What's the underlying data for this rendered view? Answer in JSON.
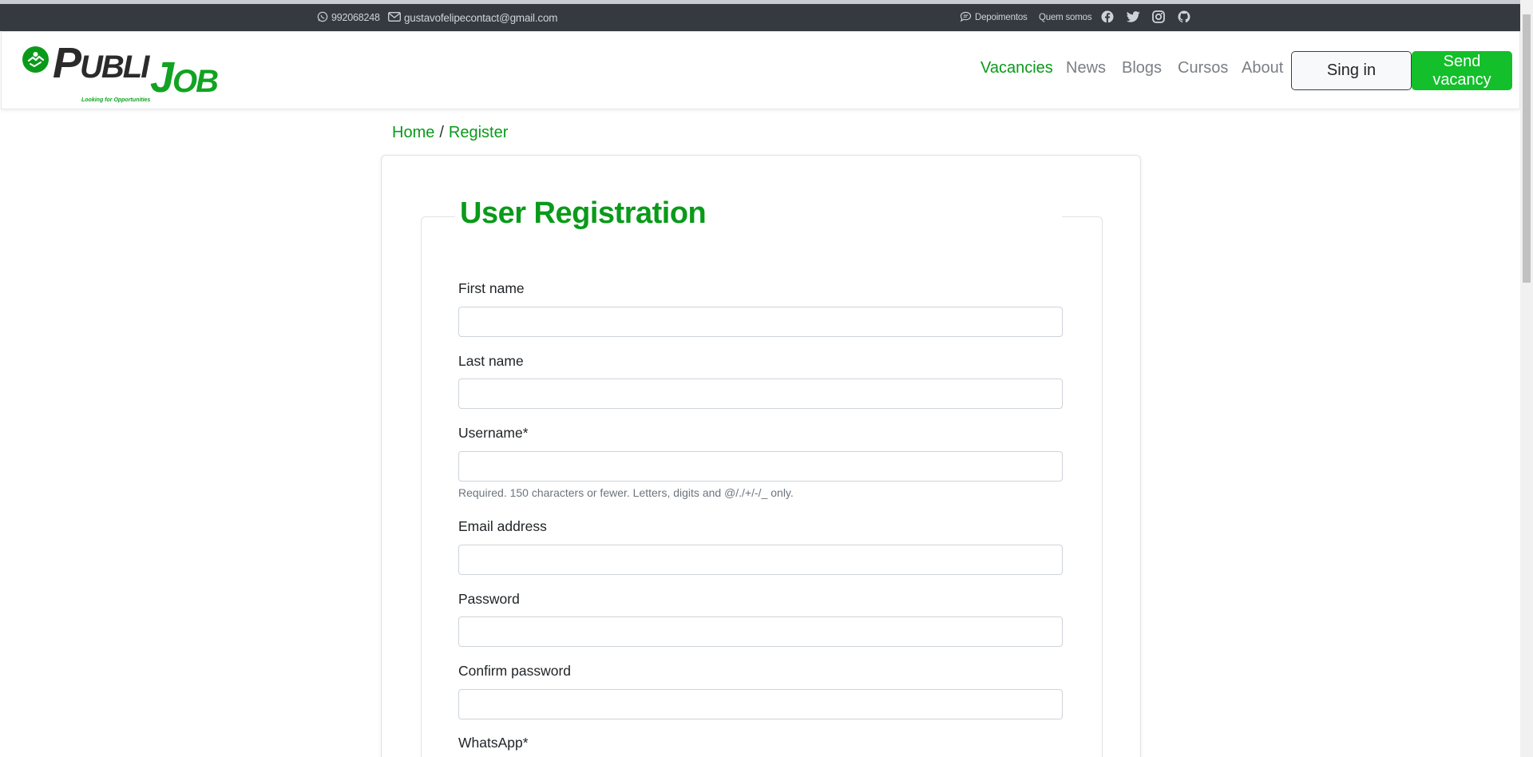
{
  "topbar": {
    "phone": "992068248",
    "email": "gustavofelipecontact@gmail.com",
    "testimonials": "Depoimentos",
    "about_us": "Quem somos",
    "phone_icon": "whatsapp-icon",
    "email_icon": "envelope-icon",
    "testimonials_icon": "chat-icon",
    "social_icons": [
      "facebook-icon",
      "twitter-icon",
      "instagram-icon",
      "github-icon"
    ]
  },
  "logo": {
    "word1_big": "P",
    "word1_rest": "UBLI",
    "word2_big": "J",
    "word2_rest": "OB",
    "tagline": "Looking for Opportunities"
  },
  "nav": {
    "items": [
      {
        "label": "Vacancies",
        "active": true
      },
      {
        "label": "News",
        "active": false
      },
      {
        "label": "Blogs",
        "active": false
      },
      {
        "label": "Cursos",
        "active": false
      },
      {
        "label": "About",
        "active": false
      }
    ],
    "signin": "Sing in",
    "send_vacancy": "Send vacancy"
  },
  "breadcrumb": {
    "home": "Home",
    "separator": "/",
    "current": "Register"
  },
  "form": {
    "title": "User Registration",
    "first_name": {
      "label": "First name",
      "value": ""
    },
    "last_name": {
      "label": "Last name",
      "value": ""
    },
    "username": {
      "label": "Username*",
      "value": "",
      "help": "Required. 150 characters or fewer. Letters, digits and @/./+/-/_ only."
    },
    "email": {
      "label": "Email address",
      "value": ""
    },
    "password": {
      "label": "Password",
      "value": ""
    },
    "confirm_password": {
      "label": "Confirm password",
      "value": ""
    },
    "whatsapp": {
      "label": "WhatsApp*"
    }
  },
  "colors": {
    "brand_green": "#0a9a1a",
    "button_green": "#13bf2a",
    "topbar_bg": "#343a40"
  }
}
